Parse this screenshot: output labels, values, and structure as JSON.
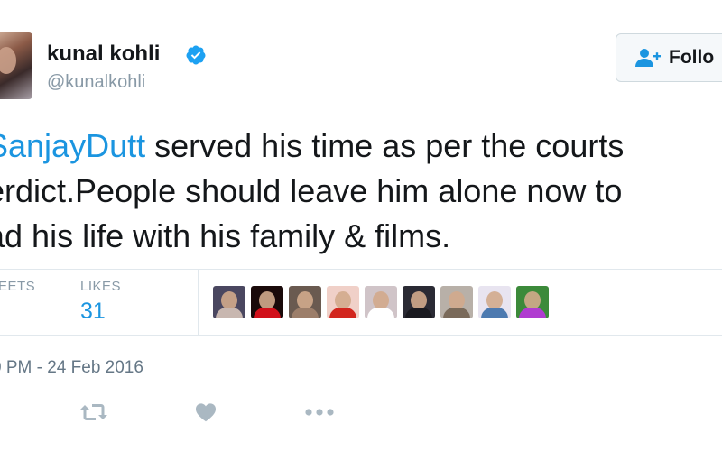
{
  "user": {
    "display_name": "kunal kohli",
    "handle": "@kunalkohli",
    "verified": true
  },
  "follow_button": {
    "label": "Follo",
    "icon": "follow-person-plus-icon"
  },
  "tweet": {
    "mention": "SanjayDutt",
    "line1_rest": " served his time as per the courts",
    "line2": "erdict.People should leave him alone now to",
    "line3": "ad his life with his family & films."
  },
  "stats": {
    "retweets_label": "EETS",
    "likes_label": "LIKES",
    "likes_count": "31"
  },
  "likers": [
    {
      "name": "liker-1",
      "bg": "#4a4760",
      "accent": "#c8b7b0"
    },
    {
      "name": "liker-2",
      "bg": "#1a0a0a",
      "accent": "#d1101a"
    },
    {
      "name": "liker-3",
      "bg": "#6a5a50",
      "accent": "#9c7e6a"
    },
    {
      "name": "liker-4",
      "bg": "#f0d0c8",
      "accent": "#d2261e"
    },
    {
      "name": "liker-5",
      "bg": "#d0c4c8",
      "accent": "#ffffff"
    },
    {
      "name": "liker-6",
      "bg": "#2a2a34",
      "accent": "#1a1a20"
    },
    {
      "name": "liker-7",
      "bg": "#b8b0a8",
      "accent": "#7a6a5a"
    },
    {
      "name": "liker-8",
      "bg": "#e8e4f0",
      "accent": "#4d7ab0"
    },
    {
      "name": "liker-9",
      "bg": "#3c8a3a",
      "accent": "#b03cd0"
    }
  ],
  "timestamp": "0 PM - 24 Feb 2016",
  "actions": {
    "retweet_icon": "retweet-icon",
    "like_icon": "heart-icon",
    "more_icon": "more-dots-icon"
  },
  "colors": {
    "link": "#1b95e0",
    "muted": "#8899a6",
    "icon": "#aab8c2"
  }
}
